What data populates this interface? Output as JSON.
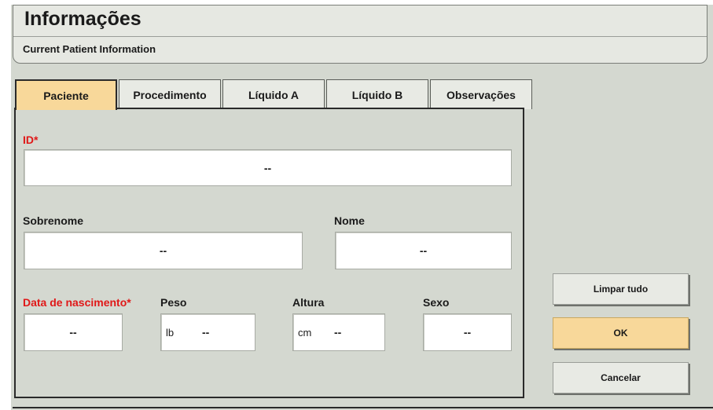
{
  "header": {
    "title": "Informações",
    "subtitle": "Current Patient Information"
  },
  "tabs": [
    {
      "label": "Paciente",
      "active": true
    },
    {
      "label": "Procedimento",
      "active": false
    },
    {
      "label": "Líquido A",
      "active": false
    },
    {
      "label": "Líquido B",
      "active": false
    },
    {
      "label": "Observações",
      "active": false
    }
  ],
  "form": {
    "id": {
      "label": "ID*",
      "value": "--",
      "required": true
    },
    "sobrenome": {
      "label": "Sobrenome",
      "value": "--"
    },
    "nome": {
      "label": "Nome",
      "value": "--"
    },
    "data_nascimento": {
      "label": "Data de nascimento*",
      "value": "--",
      "required": true
    },
    "peso": {
      "label": "Peso",
      "unit": "lb",
      "value": "--"
    },
    "altura": {
      "label": "Altura",
      "unit": "cm",
      "value": "--"
    },
    "sexo": {
      "label": "Sexo",
      "value": "--"
    }
  },
  "buttons": {
    "clear_all": "Limpar tudo",
    "ok": "OK",
    "cancel": "Cancelar"
  },
  "colors": {
    "accent": "#f8d89a",
    "required": "#e01818",
    "background": "#d4d8d0"
  }
}
